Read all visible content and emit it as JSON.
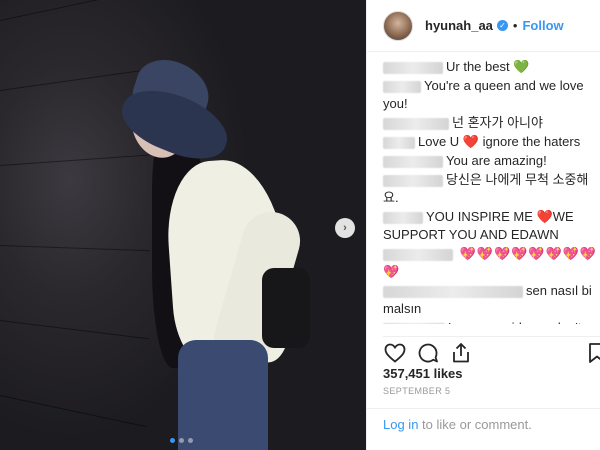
{
  "post": {
    "username": "hyunah_aa",
    "separator": "•",
    "follow_label": "Follow",
    "carousel": {
      "slide_count": 3,
      "active_index": 0
    }
  },
  "comments": [
    {
      "text": "Ur the best",
      "emoji": "💚",
      "emoji_class": "heart-green"
    },
    {
      "text": "You're a queen and we love you!"
    },
    {
      "text": "넌 혼자가 아니야"
    },
    {
      "text": "Love U",
      "emoji": "❤️",
      "emoji_class": "heart-red",
      "text_after": " ignore the haters"
    },
    {
      "text": "You are amazing!"
    },
    {
      "text": "당신은 나에게 무척 소중해요."
    },
    {
      "text": "YOU INSPIRE ME",
      "emoji": "❤️",
      "emoji_class": "heart-red",
      "text_after": "WE SUPPORT YOU AND EDAWN"
    },
    {
      "text": "",
      "emoji": "💖💖💖💖💖💖💖💖💖",
      "emoji_class": "heart-pink"
    },
    {
      "text": "sen nasıl bi malsın"
    },
    {
      "text": "Love you girl, you don't deserve this bull shit. Wishing you all the happiness and success in the world because you deserve it QUEEN of Kpop!",
      "emoji": "🔥😱💋",
      "emoji_class": ""
    }
  ],
  "stats": {
    "likes": "357,451 likes",
    "date": "SEPTEMBER 5"
  },
  "login": {
    "link": "Log in",
    "rest": " to like or comment."
  },
  "icons": [
    "heart-icon",
    "comment-icon",
    "share-icon",
    "bookmark-icon"
  ],
  "colors": {
    "link": "#3897f0",
    "verified": "#3897f0"
  }
}
